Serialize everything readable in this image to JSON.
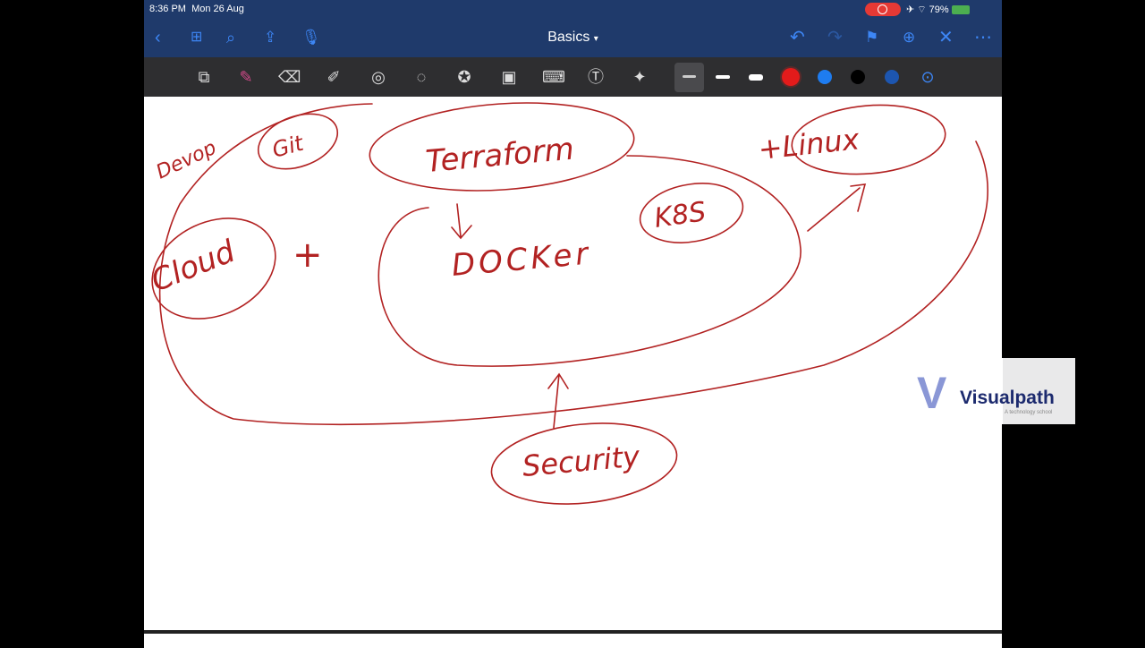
{
  "status": {
    "time": "8:36 PM",
    "date": "Mon 26 Aug",
    "battery": "79%"
  },
  "nav": {
    "title": "Basics",
    "title_caret": "▾"
  },
  "colors": {
    "ink": "#b22222",
    "nav_bg": "#1f3a6b",
    "accent": "#3d86f5"
  },
  "notes": {
    "devops": "Devop",
    "git": "Git",
    "terraform": "Terraform",
    "docker": "DOCKer",
    "k8s": "K8S",
    "linux": "+Linux",
    "cloud": "Cloud",
    "plus": "+",
    "security": "Security"
  },
  "logo": {
    "name": "Visualpath",
    "tagline": "A technology school"
  }
}
